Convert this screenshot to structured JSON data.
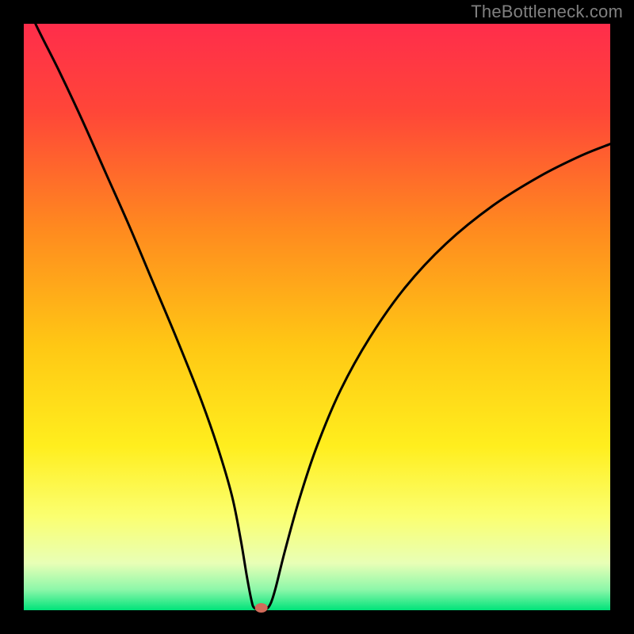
{
  "watermark": "TheBottleneck.com",
  "chart_data": {
    "type": "line",
    "title": "",
    "xlabel": "",
    "ylabel": "",
    "x_range": [
      0,
      100
    ],
    "y_range": [
      0,
      100
    ],
    "frame": {
      "inner_box": [
        30,
        30,
        770,
        770
      ],
      "stroke": "#000000",
      "fill_gradient": true
    },
    "gradient_stops": [
      {
        "offset": 0.0,
        "color": "#ff2d4b"
      },
      {
        "offset": 0.15,
        "color": "#ff4638"
      },
      {
        "offset": 0.35,
        "color": "#ff8a1f"
      },
      {
        "offset": 0.55,
        "color": "#ffc814"
      },
      {
        "offset": 0.72,
        "color": "#ffee1e"
      },
      {
        "offset": 0.84,
        "color": "#fbff70"
      },
      {
        "offset": 0.92,
        "color": "#e8ffb6"
      },
      {
        "offset": 0.965,
        "color": "#8cf7a9"
      },
      {
        "offset": 1.0,
        "color": "#00e37a"
      }
    ],
    "series": [
      {
        "name": "bottleneck-curve",
        "color": "#000000",
        "min_x": 40,
        "min_y": 0,
        "points": [
          {
            "x": 0.0,
            "y": 105.0
          },
          {
            "x": 2.0,
            "y": 100.0
          },
          {
            "x": 6.0,
            "y": 92.0
          },
          {
            "x": 10.0,
            "y": 83.5
          },
          {
            "x": 14.0,
            "y": 74.5
          },
          {
            "x": 18.0,
            "y": 65.5
          },
          {
            "x": 22.0,
            "y": 56.0
          },
          {
            "x": 26.0,
            "y": 46.5
          },
          {
            "x": 30.0,
            "y": 36.5
          },
          {
            "x": 33.0,
            "y": 28.0
          },
          {
            "x": 35.5,
            "y": 19.5
          },
          {
            "x": 37.0,
            "y": 12.0
          },
          {
            "x": 38.0,
            "y": 6.0
          },
          {
            "x": 38.8,
            "y": 1.8
          },
          {
            "x": 39.3,
            "y": 0.4
          },
          {
            "x": 40.5,
            "y": 0.2
          },
          {
            "x": 41.5,
            "y": 0.3
          },
          {
            "x": 42.2,
            "y": 1.4
          },
          {
            "x": 43.0,
            "y": 4.0
          },
          {
            "x": 44.5,
            "y": 10.0
          },
          {
            "x": 47.0,
            "y": 19.0
          },
          {
            "x": 50.0,
            "y": 28.0
          },
          {
            "x": 54.0,
            "y": 37.5
          },
          {
            "x": 59.0,
            "y": 46.5
          },
          {
            "x": 65.0,
            "y": 55.0
          },
          {
            "x": 72.0,
            "y": 62.5
          },
          {
            "x": 80.0,
            "y": 69.0
          },
          {
            "x": 88.0,
            "y": 74.0
          },
          {
            "x": 95.0,
            "y": 77.5
          },
          {
            "x": 100.0,
            "y": 79.5
          }
        ]
      }
    ],
    "marker": {
      "x": 40.5,
      "y": 0.4,
      "rx": 8,
      "ry": 6,
      "fill": "#d26b5a"
    }
  }
}
